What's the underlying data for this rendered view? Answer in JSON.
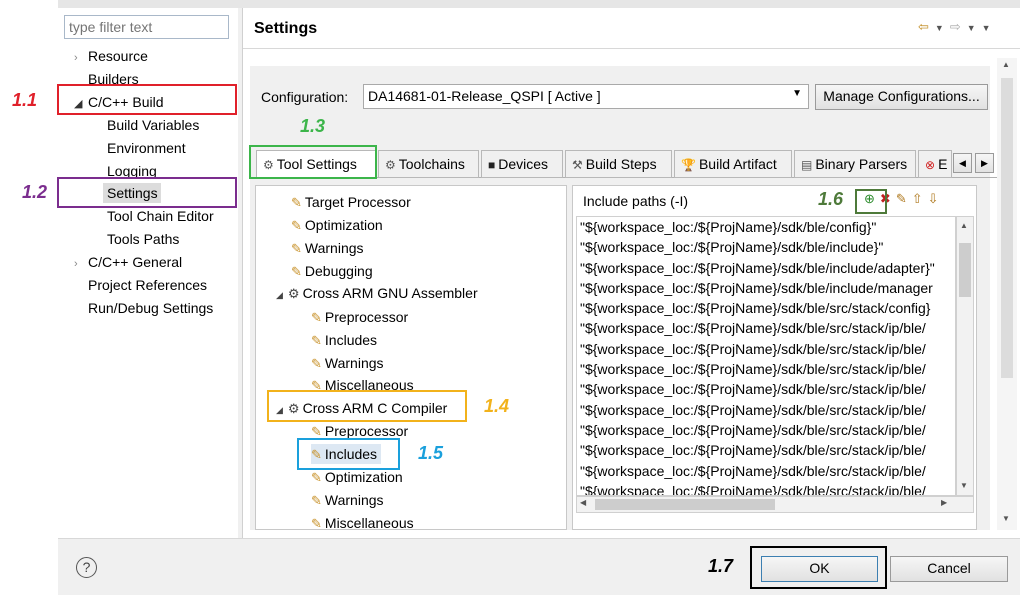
{
  "left_tree": {
    "filter_placeholder": "type filter text",
    "items": [
      {
        "label": "Resource"
      },
      {
        "label": "Builders"
      },
      {
        "label": "C/C++ Build"
      },
      {
        "label": "Build Variables"
      },
      {
        "label": "Environment"
      },
      {
        "label": "Logging"
      },
      {
        "label": "Settings"
      },
      {
        "label": "Tool Chain Editor"
      },
      {
        "label": "Tools Paths"
      },
      {
        "label": "C/C++ General"
      },
      {
        "label": "Project References"
      },
      {
        "label": "Run/Debug Settings"
      }
    ]
  },
  "header": {
    "title": "Settings"
  },
  "config": {
    "label": "Configuration:",
    "value": "DA14681-01-Release_QSPI  [ Active ]",
    "manage_button": "Manage Configurations..."
  },
  "tabs": [
    "Tool Settings",
    "Toolchains",
    "Devices",
    "Build Steps",
    "Build Artifact",
    "Binary Parsers",
    "E"
  ],
  "tool_tree": [
    "Target Processor",
    "Optimization",
    "Warnings",
    "Debugging",
    "Cross ARM GNU Assembler",
    "Preprocessor",
    "Includes",
    "Warnings",
    "Miscellaneous",
    "Cross ARM C Compiler",
    "Preprocessor",
    "Includes",
    "Optimization",
    "Warnings",
    "Miscellaneous"
  ],
  "include_panel": {
    "header": "Include paths (-I)",
    "paths": [
      "\"${workspace_loc:/${ProjName}/sdk/ble/config}\"",
      "\"${workspace_loc:/${ProjName}/sdk/ble/include}\"",
      "\"${workspace_loc:/${ProjName}/sdk/ble/include/adapter}\"",
      "\"${workspace_loc:/${ProjName}/sdk/ble/include/manager",
      "\"${workspace_loc:/${ProjName}/sdk/ble/src/stack/config}",
      "\"${workspace_loc:/${ProjName}/sdk/ble/src/stack/ip/ble/",
      "\"${workspace_loc:/${ProjName}/sdk/ble/src/stack/ip/ble/",
      "\"${workspace_loc:/${ProjName}/sdk/ble/src/stack/ip/ble/",
      "\"${workspace_loc:/${ProjName}/sdk/ble/src/stack/ip/ble/",
      "\"${workspace_loc:/${ProjName}/sdk/ble/src/stack/ip/ble/",
      "\"${workspace_loc:/${ProjName}/sdk/ble/src/stack/ip/ble/",
      "\"${workspace_loc:/${ProjName}/sdk/ble/src/stack/ip/ble/",
      "\"${workspace_loc:/${ProjName}/sdk/ble/src/stack/ip/ble/",
      "\"${workspace_loc:/${ProjName}/sdk/ble/src/stack/ip/ble/"
    ]
  },
  "buttons": {
    "ok": "OK",
    "cancel": "Cancel",
    "help": "?"
  },
  "markers": {
    "m1_1": "1.1",
    "m1_2": "1.2",
    "m1_3": "1.3",
    "m1_4": "1.4",
    "m1_5": "1.5",
    "m1_6": "1.6",
    "m1_7": "1.7"
  },
  "colors": {
    "red": "#e0202a",
    "purple": "#7b2d8e",
    "green": "#3cb54a",
    "orange": "#f2b21b",
    "blue": "#1aa0dc",
    "olive": "#4e7a3a",
    "black": "#000000"
  }
}
